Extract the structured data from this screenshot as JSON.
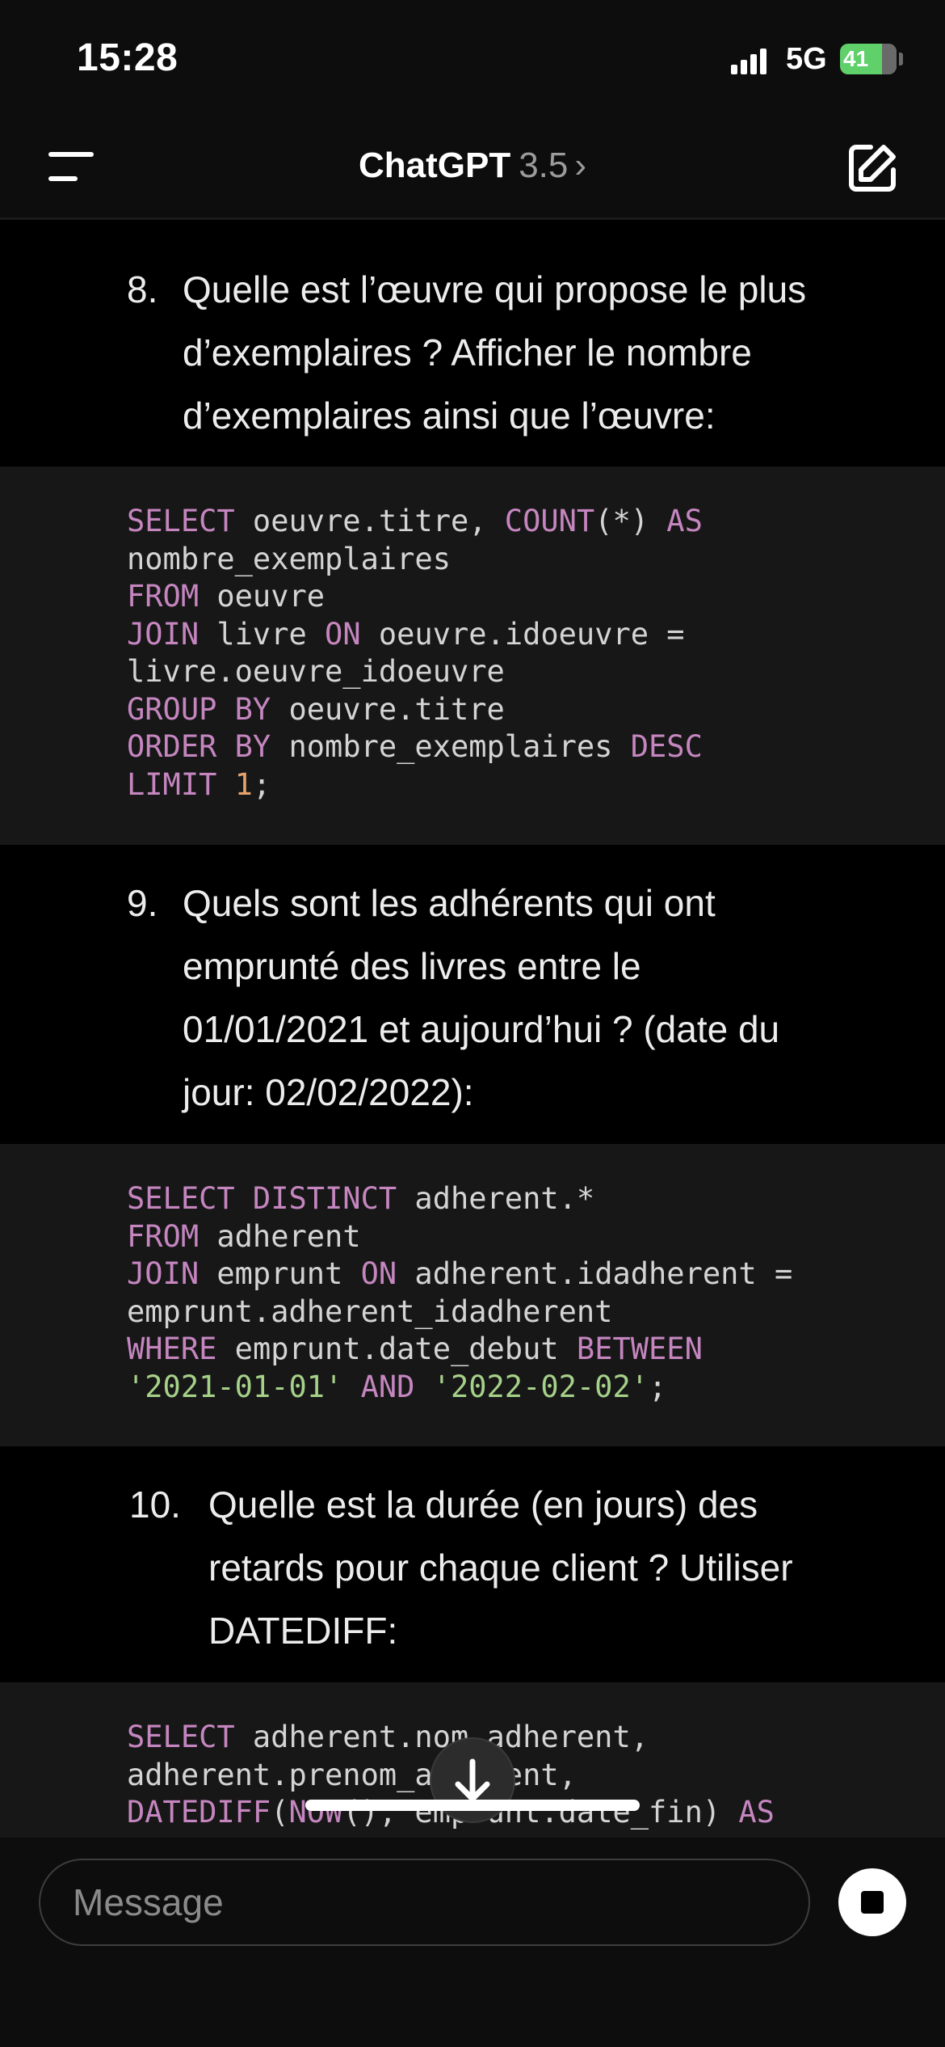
{
  "status_bar": {
    "time": "15:28",
    "network": "5G",
    "battery": "41"
  },
  "header": {
    "title": "ChatGPT",
    "version": "3.5",
    "chevron": "›"
  },
  "items": [
    {
      "number": "8.",
      "lines": [
        "Quelle est l’œuvre qui propose le plus",
        "d’exemplaires ? Afficher le nombre",
        "d’exemplaires ainsi que l’œuvre:"
      ]
    },
    {
      "number": "9.",
      "lines": [
        "Quels sont les adhérents qui ont",
        "emprunté des livres entre le",
        "01/01/2021 et aujourd’hui ? (date du",
        "jour: 02/02/2022):"
      ]
    },
    {
      "number": "10.",
      "lines": [
        "Quelle est la durée (en jours) des",
        "retards pour chaque client ? Utiliser",
        "DATEDIFF:"
      ]
    }
  ],
  "code_blocks": [
    {
      "lines": [
        [
          [
            "kw",
            "SELECT"
          ],
          [
            "t",
            " oeuvre.titre, "
          ],
          [
            "kw",
            "COUNT"
          ],
          [
            "t",
            "(*) "
          ],
          [
            "kw",
            "AS"
          ]
        ],
        [
          [
            "t",
            "nombre_exemplaires"
          ]
        ],
        [
          [
            "kw",
            "FROM"
          ],
          [
            "t",
            " oeuvre"
          ]
        ],
        [
          [
            "kw",
            "JOIN"
          ],
          [
            "t",
            " livre "
          ],
          [
            "kw",
            "ON"
          ],
          [
            "t",
            " oeuvre.idoeuvre ="
          ]
        ],
        [
          [
            "t",
            "livre.oeuvre_idoeuvre"
          ]
        ],
        [
          [
            "kw",
            "GROUP BY"
          ],
          [
            "t",
            " oeuvre.titre"
          ]
        ],
        [
          [
            "kw",
            "ORDER BY"
          ],
          [
            "t",
            " nombre_exemplaires "
          ],
          [
            "kw",
            "DESC"
          ]
        ],
        [
          [
            "kw",
            "LIMIT"
          ],
          [
            "t",
            " "
          ],
          [
            "num",
            "1"
          ],
          [
            "t",
            ";"
          ]
        ]
      ]
    },
    {
      "lines": [
        [
          [
            "kw",
            "SELECT DISTINCT"
          ],
          [
            "t",
            " adherent.*"
          ]
        ],
        [
          [
            "kw",
            "FROM"
          ],
          [
            "t",
            " adherent"
          ]
        ],
        [
          [
            "kw",
            "JOIN"
          ],
          [
            "t",
            " emprunt "
          ],
          [
            "kw",
            "ON"
          ],
          [
            "t",
            " adherent.idadherent ="
          ]
        ],
        [
          [
            "t",
            "emprunt.adherent_idadherent"
          ]
        ],
        [
          [
            "kw",
            "WHERE"
          ],
          [
            "t",
            " emprunt.date_debut "
          ],
          [
            "kw",
            "BETWEEN"
          ]
        ],
        [
          [
            "str",
            "'2021-01-01'"
          ],
          [
            "t",
            " "
          ],
          [
            "kw",
            "AND"
          ],
          [
            "t",
            " "
          ],
          [
            "str",
            "'2022-02-02'"
          ],
          [
            "t",
            ";"
          ]
        ]
      ]
    },
    {
      "lines": [
        [
          [
            "kw",
            "SELECT"
          ],
          [
            "t",
            " adherent.nom_adherent,"
          ]
        ],
        [
          [
            "t",
            "adherent.prenom_adherent,"
          ]
        ],
        [
          [
            "kw",
            "DATEDIFF"
          ],
          [
            "t",
            "("
          ],
          [
            "kw",
            "NOW"
          ],
          [
            "t",
            "(), emprunt.date_fin) "
          ],
          [
            "kw",
            "AS"
          ]
        ]
      ]
    }
  ],
  "input": {
    "placeholder": "Message"
  },
  "icons": {
    "menu": "menu-icon",
    "compose": "compose-icon",
    "scroll_down": "arrow-down-icon",
    "stop": "stop-icon"
  }
}
